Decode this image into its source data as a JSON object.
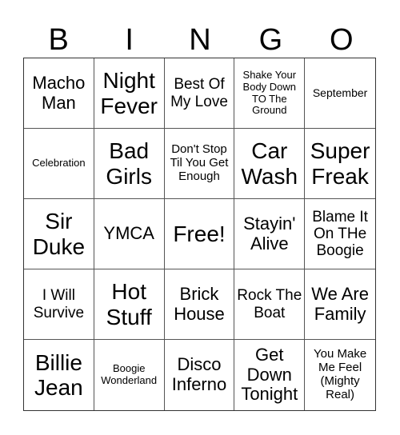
{
  "header": [
    "B",
    "I",
    "N",
    "G",
    "O"
  ],
  "cells": [
    "Macho Man",
    "Night Fever",
    "Best Of My Love",
    "Shake Your Body Down TO The Ground",
    "September",
    "Celebration",
    "Bad Girls",
    "Don't Stop Til You Get Enough",
    "Car Wash",
    "Super Freak",
    "Sir Duke",
    "YMCA",
    "Free!",
    "Stayin' Alive",
    "Blame It On THe Boogie",
    "I Will Survive",
    "Hot Stuff",
    "Brick House",
    "Rock The Boat",
    "We Are Family",
    "Billie Jean",
    "Boogie Wonderland",
    "Disco Inferno",
    "Get Down Tonight",
    "You Make Me Feel (Mighty Real)"
  ]
}
